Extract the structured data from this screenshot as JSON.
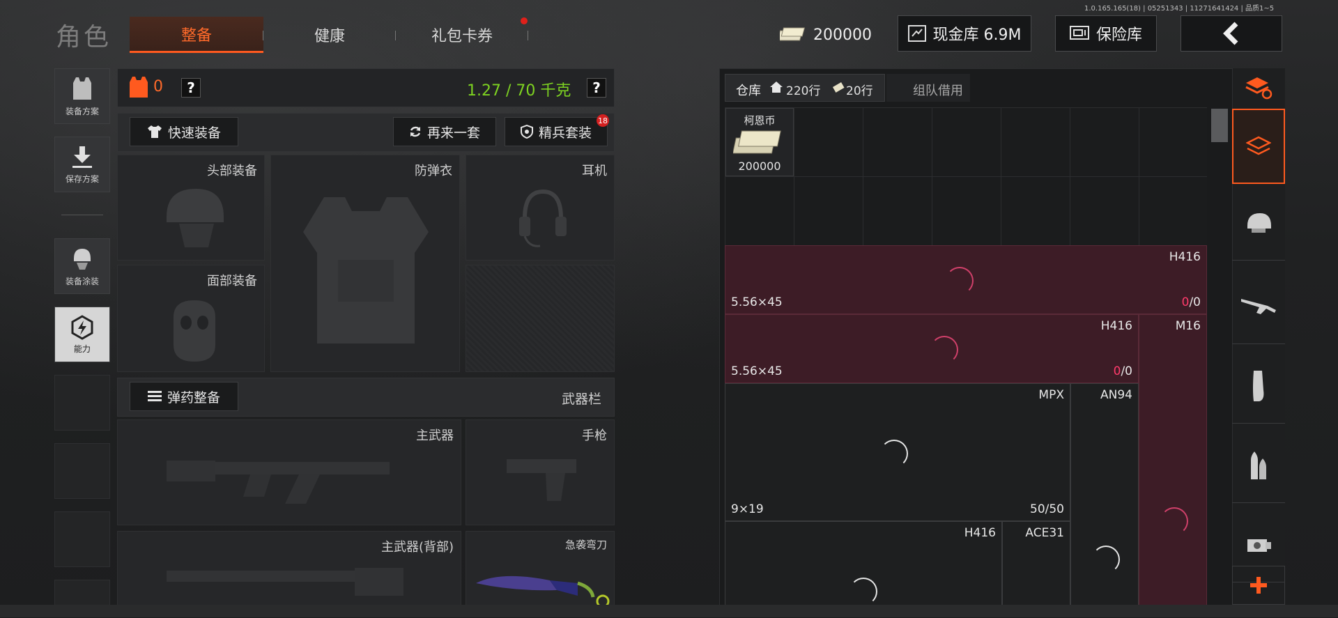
{
  "version": "1.0.165.165(18) | 05251343 | 11271641424 | 品质1~5",
  "header": {
    "title": "角色",
    "tabs": [
      {
        "label": "整备",
        "active": true
      },
      {
        "label": "健康",
        "active": false
      },
      {
        "label": "礼包卡券",
        "active": false,
        "badge": true
      }
    ],
    "money": "200000",
    "cash_vault": "现金库 6.9M",
    "safe_vault": "保险库"
  },
  "left_menu": [
    {
      "label": "装备方案",
      "icon": "vest-icon"
    },
    {
      "label": "保存方案",
      "icon": "download-icon"
    },
    {
      "label": "装备涂装",
      "icon": "helmet-paint-icon"
    },
    {
      "label": "能力",
      "icon": "lightning-icon",
      "highlight": true
    }
  ],
  "loadout": {
    "armor_count": "0",
    "question": "?",
    "weight": "1.27 / 70 千克",
    "quick_equip": "快速装备",
    "reroll": "再来一套",
    "elite_set": "精兵套装",
    "elite_badge": "18",
    "slots": {
      "head": "头部装备",
      "armor": "防弹衣",
      "earphone": "耳机",
      "face": "面部装备"
    },
    "ammo_equip": "弹药整备",
    "weapon_bar": "武器栏",
    "weapons": {
      "primary": "主武器",
      "pistol": "手枪",
      "primary_back": "主武器(背部)",
      "knife": "急袭弯刀"
    }
  },
  "storage": {
    "tabs": [
      {
        "label": "仓库",
        "active": true
      },
      {
        "label": "220行",
        "icon": "home-icon"
      },
      {
        "label": "20行",
        "icon": "ticket-icon"
      },
      {
        "label": "组队借用",
        "active": false
      }
    ],
    "items": [
      {
        "name": "柯恩币",
        "count": "200000"
      },
      {
        "name": "H416",
        "caliber": "5.56×45",
        "count_red": "0",
        "count_rest": "/0"
      },
      {
        "name": "H416",
        "caliber": "5.56×45",
        "count_red": "0",
        "count_rest": "/0"
      },
      {
        "name": "M16"
      },
      {
        "name": "MPX",
        "caliber": "9×19",
        "count": "50/50"
      },
      {
        "name": "AN94"
      },
      {
        "name": "H416"
      },
      {
        "name": "ACE31"
      }
    ]
  },
  "colors": {
    "accent": "#ff5a1f",
    "money_green": "#7ed321",
    "locked_red": "#3d1c26",
    "count_red": "#ff3b6b"
  }
}
